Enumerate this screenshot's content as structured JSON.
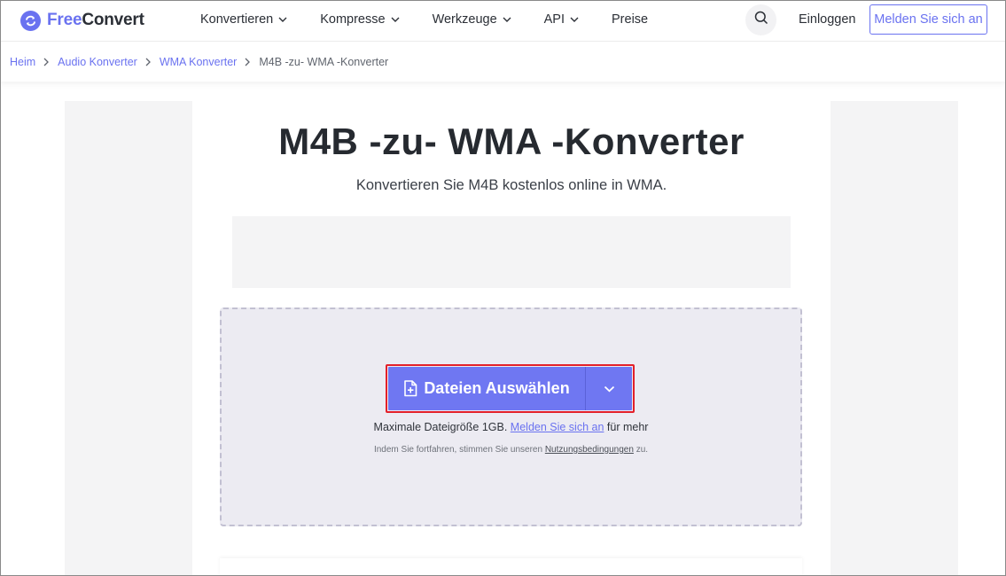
{
  "brand": {
    "free": "Free",
    "convert": "Convert",
    "accent": "#6a72f0"
  },
  "nav": {
    "items": [
      {
        "label": "Konvertieren"
      },
      {
        "label": "Kompresse"
      },
      {
        "label": "Werkzeuge"
      },
      {
        "label": "API"
      },
      {
        "label": "Preise"
      }
    ],
    "login": "Einloggen",
    "signup": "Melden Sie sich an"
  },
  "breadcrumb": {
    "items": [
      "Heim",
      "Audio Konverter",
      "WMA Konverter"
    ],
    "current": "M4B -zu- WMA -Konverter"
  },
  "main": {
    "title": "M4B -zu- WMA -Konverter",
    "subtitle": "Konvertieren Sie M4B kostenlos online in WMA."
  },
  "upload": {
    "button_label": "Dateien Auswählen",
    "limit_prefix": "Maximale Dateigröße 1GB.",
    "limit_link": "Melden Sie sich an",
    "limit_suffix": "für mehr",
    "terms_prefix": "Indem Sie fortfahren, stimmen Sie unseren",
    "terms_link": "Nutzungsbedingungen",
    "terms_suffix": "zu.",
    "highlight_color": "#e3202a",
    "button_color": "#6f77f2"
  }
}
